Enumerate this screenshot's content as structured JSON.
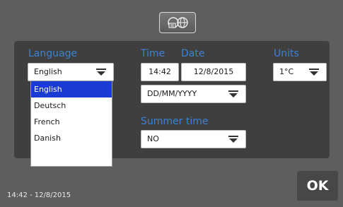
{
  "header": {
    "icon": "globe-settings-icon"
  },
  "language": {
    "label": "Language",
    "value": "English",
    "options": [
      {
        "label": "English",
        "selected": true
      },
      {
        "label": "Deutsch",
        "selected": false
      },
      {
        "label": "French",
        "selected": false
      },
      {
        "label": "Danish",
        "selected": false
      }
    ]
  },
  "time": {
    "label": "Time",
    "value": "14:42"
  },
  "date": {
    "label": "Date",
    "value": "12/8/2015",
    "format": "DD/MM/YYYY"
  },
  "units": {
    "label": "Units",
    "value": "1°C"
  },
  "summer_time": {
    "label": "Summer time",
    "value": "NO"
  },
  "status": {
    "text": "14:42 - 12/8/2015"
  },
  "actions": {
    "ok_label": "OK"
  },
  "colors": {
    "accent": "#3b82d6",
    "selection": "#1c3bd4",
    "background": "#5e5e5e",
    "panel": "#3f3f3f"
  }
}
